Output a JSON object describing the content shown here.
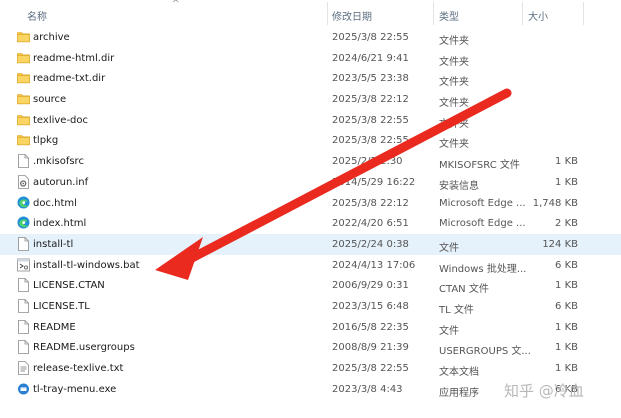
{
  "columns": {
    "name": "名称",
    "date": "修改日期",
    "type": "类型",
    "size": "大小"
  },
  "files": [
    {
      "name": "archive",
      "date": "2025/3/8 22:55",
      "type": "文件夹",
      "size": "",
      "icon": "folder-icon"
    },
    {
      "name": "readme-html.dir",
      "date": "2024/6/21 9:41",
      "type": "文件夹",
      "size": "",
      "icon": "folder-icon"
    },
    {
      "name": "readme-txt.dir",
      "date": "2023/5/5 23:38",
      "type": "文件夹",
      "size": "",
      "icon": "folder-icon"
    },
    {
      "name": "source",
      "date": "2025/3/8 22:12",
      "type": "文件夹",
      "size": "",
      "icon": "folder-icon"
    },
    {
      "name": "texlive-doc",
      "date": "2025/3/8 22:55",
      "type": "文件夹",
      "size": "",
      "icon": "folder-icon"
    },
    {
      "name": "tlpkg",
      "date": "2025/3/8 22:55",
      "type": "文件夹",
      "size": "",
      "icon": "folder-icon"
    },
    {
      "name": ".mkisofsrc",
      "date": "2025/2/2 2:30",
      "type": "MKISOFSRC 文件",
      "size": "1 KB",
      "icon": "file-icon"
    },
    {
      "name": "autorun.inf",
      "date": "2014/5/29 16:22",
      "type": "安装信息",
      "size": "1 KB",
      "icon": "settings-file-icon"
    },
    {
      "name": "doc.html",
      "date": "2025/3/8 22:12",
      "type": "Microsoft Edge ...",
      "size": "1,748 KB",
      "icon": "edge-icon"
    },
    {
      "name": "index.html",
      "date": "2022/4/20 6:51",
      "type": "Microsoft Edge ...",
      "size": "2 KB",
      "icon": "edge-icon"
    },
    {
      "name": "install-tl",
      "date": "2025/2/24 0:38",
      "type": "文件",
      "size": "124 KB",
      "icon": "file-icon"
    },
    {
      "name": "install-tl-windows.bat",
      "date": "2024/4/13 17:06",
      "type": "Windows 批处理...",
      "size": "6 KB",
      "icon": "batch-file-icon"
    },
    {
      "name": "LICENSE.CTAN",
      "date": "2006/9/29 0:31",
      "type": "CTAN 文件",
      "size": "1 KB",
      "icon": "file-icon"
    },
    {
      "name": "LICENSE.TL",
      "date": "2023/3/15 6:48",
      "type": "TL 文件",
      "size": "6 KB",
      "icon": "file-icon"
    },
    {
      "name": "README",
      "date": "2016/5/8 22:35",
      "type": "文件",
      "size": "1 KB",
      "icon": "file-icon"
    },
    {
      "name": "README.usergroups",
      "date": "2008/8/9 21:39",
      "type": "USERGROUPS 文...",
      "size": "1 KB",
      "icon": "file-icon"
    },
    {
      "name": "release-texlive.txt",
      "date": "2025/3/8 22:55",
      "type": "文本文档",
      "size": "1 KB",
      "icon": "text-file-icon"
    },
    {
      "name": "tl-tray-menu.exe",
      "date": "2023/3/8 4:43",
      "type": "应用程序",
      "size": "6 KB",
      "icon": "exe-icon"
    }
  ],
  "selected_index": 10,
  "annotation_color": "#ea2a1f",
  "watermark": "知乎 @冷血"
}
